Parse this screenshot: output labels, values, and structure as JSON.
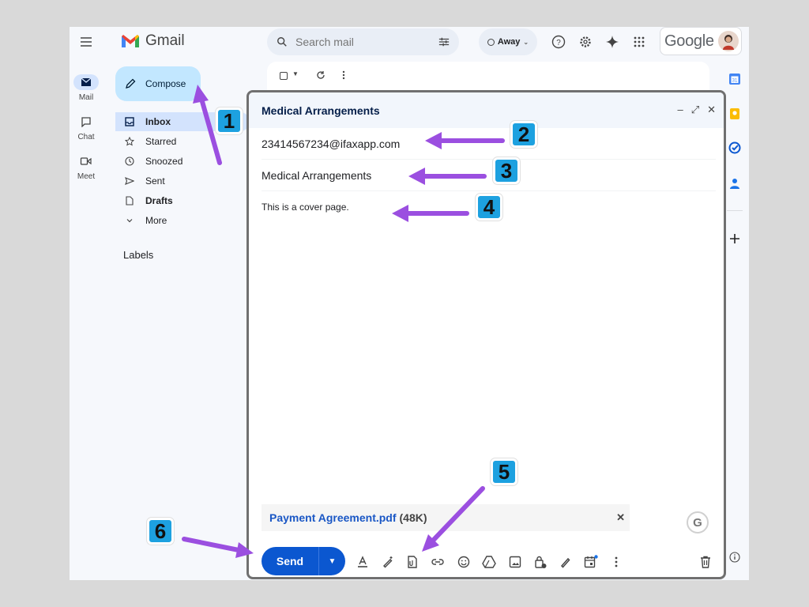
{
  "header": {
    "app_name": "Gmail",
    "search_placeholder": "Search mail",
    "status": "Away",
    "google_word": "Google"
  },
  "rail": [
    {
      "label": "Mail",
      "icon": "mail-icon"
    },
    {
      "label": "Chat",
      "icon": "chat-icon"
    },
    {
      "label": "Meet",
      "icon": "meet-icon"
    }
  ],
  "sidebar": {
    "compose_label": "Compose",
    "items": [
      {
        "label": "Inbox",
        "icon": "inbox-icon"
      },
      {
        "label": "Starred",
        "icon": "star-icon"
      },
      {
        "label": "Snoozed",
        "icon": "clock-icon"
      },
      {
        "label": "Sent",
        "icon": "send-icon"
      },
      {
        "label": "Drafts",
        "icon": "draft-icon"
      },
      {
        "label": "More",
        "icon": "chevron-down-icon"
      }
    ],
    "labels_heading": "Labels"
  },
  "compose": {
    "title": "Medical Arrangements",
    "to": "23414567234@ifaxapp.com",
    "subject": "Medical Arrangements",
    "body": "This is a cover page.",
    "attachment_name": "Payment Agreement.pdf",
    "attachment_size": "(48K)",
    "send_label": "Send"
  },
  "annotations": [
    "1",
    "2",
    "3",
    "4",
    "5",
    "6"
  ],
  "colors": {
    "accent": "#0b57d0",
    "compose_button": "#c2e7ff",
    "badge": "#1da1e0",
    "arrow": "#9b4fe0"
  }
}
